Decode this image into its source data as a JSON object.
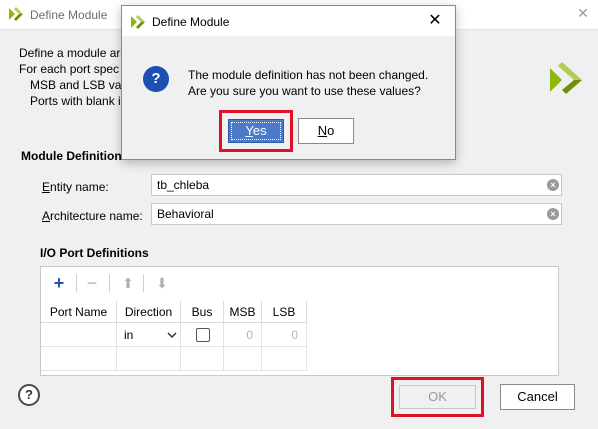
{
  "window": {
    "title": "Define Module",
    "close_glyph": "✕"
  },
  "description": {
    "line1": "Define a module ar",
    "line2": "For each port spec",
    "line3": "MSB and LSB va",
    "line4": "Ports with blank i"
  },
  "module_definition": {
    "section_label": "Module Definition",
    "entity_label_u": "E",
    "entity_label_rest": "ntity name:",
    "entity_value": "tb_chleba",
    "architecture_label_u": "A",
    "architecture_label_rest": "rchitecture name:",
    "architecture_value": "Behavioral"
  },
  "io_ports": {
    "section_label": "I/O Port Definitions",
    "toolbar": {
      "add_glyph": "+",
      "remove_glyph": "−",
      "up_glyph": "⬆",
      "down_glyph": "⬇"
    },
    "columns": [
      "Port Name",
      "Direction",
      "Bus",
      "MSB",
      "LSB"
    ],
    "rows": [
      {
        "port_name": "",
        "direction": "in",
        "bus": false,
        "msb": "0",
        "lsb": "0"
      }
    ]
  },
  "footer": {
    "help_glyph": "?",
    "ok_label": "OK",
    "cancel_label": "Cancel"
  },
  "modal": {
    "title": "Define Module",
    "close_glyph": "✕",
    "icon_glyph": "?",
    "message_line1": "The module definition has not been changed.",
    "message_line2": "Are you sure you want to use these values?",
    "yes_label_u": "Y",
    "yes_label_rest": "es",
    "no_label_u": "N",
    "no_label_rest": "o"
  },
  "colors": {
    "brand_green": "#8fb70a",
    "highlight_red": "#e01025",
    "question_blue": "#1d4fb0",
    "yes_blue": "#4a7ac9",
    "add_blue": "#1e56b0"
  },
  "icons": {
    "app": "vivado-logo-icon",
    "question": "question-icon",
    "add": "plus-icon",
    "remove": "minus-icon",
    "up": "arrow-up-icon",
    "down": "arrow-down-icon",
    "clear": "clear-icon",
    "help": "help-icon",
    "dropdown": "chevron-down-icon"
  }
}
